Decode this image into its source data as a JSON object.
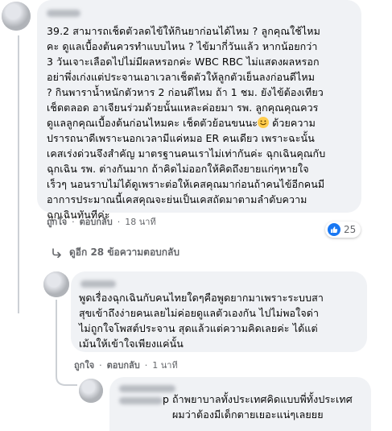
{
  "comment1": {
    "text_part1": "39.2 สามารถเช็ดตัวลดไข้ให้กินยาก่อนได้ไหม ? ลูกคุณใช้ไหม\nคะ ดูแลเบื้องต้นควรทำแบบไหน ? ไข้มากี่วันแล้ว หากน้อยกว่า\n3 วันเจาะเลือดไปไม่มีผลหรอกค่ะ WBC RBC ไม่แสดงผลหรอก\nอย่าพึ่งเก่งแต่ประจานเอาเวลาเช็ดตัวให้ลูกตัวเย็นลงก่อนดีไหม\n? กินพาราน้ำหนักตัวหาร 2 ก่อนดีไหม ถ้า 1 ชม. ยังไข้ต้องเทียว\nเช็ดตลอด อาเจียนร่วมด้วยนั้นแหละค่อยมา รพ. ลูกคุณคุณควร\nดูแลลูกคุณเบื้องต้นก่อนไหมคะ เช็ดตัวย้อนขนนะ",
    "text_part2": " ด้วยความ\nปรารถนาดีเพราะนอกเวลามีแค่หมอ ER คนเดียว เพราะฉะนั้น\nเคสเร่งด่วนจึงสำคัญ มาตรฐานคนเราไม่เท่ากันค่ะ ฉุกเฉินคุณกับ\nฉุกเฉิน รพ. ต่างกันมาก ถ้าคิดไม่ออกให้คิดถึงยายแก่ๆหายใจ\nเร็วๆ นอนราบไม่ได้ดูเพราะต่อให้เคสคุณมาก่อนถ้าคนไข้อีกคนมี\nอาการประมาณนี้เคสคุณจะย่นเป็นเคสถัดมาตามลำดับความ\nฉุกเฉินทันทีค่ะ",
    "emoji_name": "smiling-face-emoji",
    "like_label": "ถูกใจ",
    "reply_label": "ตอบกลับ",
    "time": "18 นาที",
    "reaction_count": "25"
  },
  "view_replies_label": "ดูอีก 28 ข้อความตอบกลับ",
  "comment2": {
    "text": "พูดเรื่องฉุกเฉินกับคนไทยใดๆคือพูดยากมาเพราะระบบสา\nสุขเข้าถึงง่ายคนเลยไม่ค่อยดูแลตัวเองกัน ไปไม่พอใจด่า\nไม่ถูกใจโพสต์ประจาน สุดแล้วแต่ความคิดเลยค่ะ ได้แต่\nเม้นให้เข้าใจเพียงแค่นั้น",
    "like_label": "ถูกใจ",
    "reply_label": "ตอบกลับ",
    "time": "1 นาที"
  },
  "comment3": {
    "name_suffix": "p",
    "text": "ถ้าพยาบาลทั้งประเทศคิดแบบพี่ทั้งประเทศ\nผมว่าต้องมีเด็กตายเยอะแน่ๆเลยยย"
  },
  "colors": {
    "bubble": "#f0f2f5",
    "like_blue": "#1877f2",
    "muted": "#65676b"
  }
}
